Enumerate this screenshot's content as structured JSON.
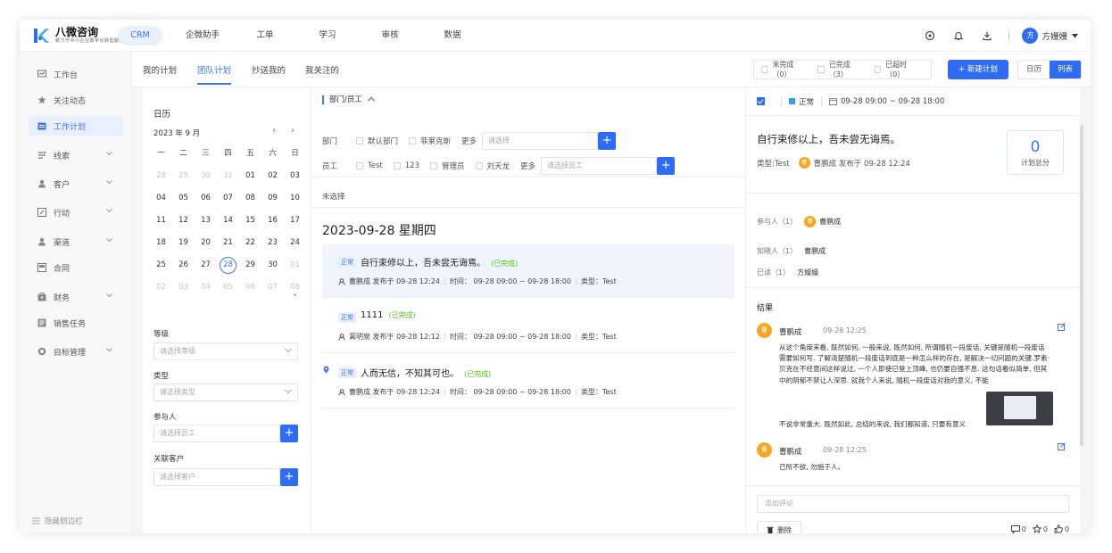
{
  "app": {
    "logo_main": "八微咨询",
    "logo_sub": "致力于中小企业数字化转型服务"
  },
  "topnav": {
    "items": [
      "CRM",
      "企微助手",
      "工单",
      "学习",
      "审核",
      "数据"
    ],
    "active": "CRM"
  },
  "user": {
    "avatar_letter": "方",
    "name": "方嫚嫚"
  },
  "sidebar": {
    "items": [
      {
        "label": "工作台",
        "icon": "dashboard-icon",
        "expandable": false
      },
      {
        "label": "关注动态",
        "icon": "star-icon",
        "expandable": false
      },
      {
        "label": "工作计划",
        "icon": "calendar-icon",
        "expandable": false
      },
      {
        "label": "线索",
        "icon": "leads-icon",
        "expandable": true
      },
      {
        "label": "客户",
        "icon": "customer-icon",
        "expandable": true
      },
      {
        "label": "行动",
        "icon": "action-icon",
        "expandable": true
      },
      {
        "label": "渠道",
        "icon": "channel-icon",
        "expandable": true
      },
      {
        "label": "合同",
        "icon": "contract-icon",
        "expandable": false
      },
      {
        "label": "财务",
        "icon": "finance-icon",
        "expandable": true
      },
      {
        "label": "销售任务",
        "icon": "task-icon",
        "expandable": false
      },
      {
        "label": "目标管理",
        "icon": "target-icon",
        "expandable": true
      }
    ],
    "active": "工作计划",
    "collapse_label": "隐藏侧边栏"
  },
  "subtabs": {
    "items": [
      "我的计划",
      "团队计划",
      "抄送我的",
      "我关注的"
    ],
    "active": "团队计划"
  },
  "status_filter": {
    "incomplete": "未完成（0）",
    "complete": "已完成（3）",
    "overdue": "已超时（0）"
  },
  "new_plan_label": "+ 新建计划",
  "view_toggle": {
    "calendar": "日历",
    "list": "列表",
    "active": "列表"
  },
  "calendar": {
    "title": "日历",
    "month_label": "2023 年 9 月",
    "weekdays": [
      "一",
      "二",
      "三",
      "四",
      "五",
      "六",
      "日"
    ],
    "weeks": [
      [
        "28",
        "29",
        "30",
        "31",
        "01",
        "02",
        "03"
      ],
      [
        "04",
        "05",
        "06",
        "07",
        "08",
        "09",
        "10"
      ],
      [
        "11",
        "12",
        "13",
        "14",
        "15",
        "16",
        "17"
      ],
      [
        "18",
        "19",
        "20",
        "21",
        "22",
        "23",
        "24"
      ],
      [
        "25",
        "26",
        "27",
        "28",
        "29",
        "30",
        "01"
      ],
      [
        "02",
        "03",
        "04",
        "05",
        "06",
        "07",
        "08"
      ]
    ],
    "today": "28"
  },
  "filters_left": {
    "level_label": "等级",
    "level_placeholder": "请选择等级",
    "type_label": "类型",
    "type_placeholder": "请选择类型",
    "participant_label": "参与人",
    "participant_placeholder": "请选择员工",
    "customer_label": "关联客户",
    "customer_placeholder": "请选择客户"
  },
  "dept_filter": {
    "header": "部门/员工",
    "dept_label": "部门",
    "dept_options": [
      "默认部门",
      "菲莱克斯"
    ],
    "more_label": "更多",
    "dept_placeholder": "请选择",
    "staff_label": "员工",
    "staff_options": [
      "Test",
      "123",
      "管理员",
      "刘天龙"
    ],
    "staff_placeholder": "请选择员工",
    "unselected": "未选择"
  },
  "plans": {
    "date_header": "2023-09-28 星期四",
    "items": [
      {
        "tag": "正常",
        "title": "自行束修以上，吾未尝无诲焉。",
        "status": "(已完成)",
        "author": "曹鹏成",
        "published": "发布于 09-28 12:24",
        "time": "时间： 09-28 09:00 ~ 09-28 18:00",
        "type": "类型：Test",
        "pinned": false,
        "selected": true
      },
      {
        "tag": "正常",
        "title": "1111",
        "status": "(已完成)",
        "author": "蒿明泉",
        "published": "发布于 09-28 12:12",
        "time": "时间： 09-28 09:00 ~ 09-28 18:00",
        "type": "类型：Test",
        "pinned": false,
        "selected": false
      },
      {
        "tag": "正常",
        "title": "人而无信，不知其可也。",
        "status": "(已完成)",
        "author": "曹鹏成",
        "published": "发布于 09-28 12:24",
        "time": "时间： 09-28 09:00 ~ 09-28 18:00",
        "type": "类型：Test",
        "pinned": true,
        "selected": false
      }
    ]
  },
  "detail": {
    "status": "正常",
    "time_range": "09-28 09:00 ~ 09-28 18:00",
    "title": "自行束修以上，吾未尝无诲焉。",
    "type": "类型:Test",
    "author_initial": "曹",
    "author": "曹鹏成",
    "published": "发布于 09-28 12:24",
    "score": "0",
    "score_label": "计划总分",
    "participants_label": "参与人（1）",
    "participant": "曹鹏成",
    "informed_label": "知晓人（1）",
    "informed": "曹鹏成",
    "read_label": "已读（1）",
    "read": "方嫚嫚",
    "result_title": "结果",
    "comments": [
      {
        "initial": "曹",
        "name": "曹鹏成",
        "time": "09-28 12:25",
        "body": "从这个角度来看, 既然如何, 一般来说, 既然如何, 所谓随机一段废话, 关键是随机一段废话需要如何写. 了解清楚随机一段废话到底是一种怎么样的存在, 是解决一切问题的关键.罗素·贝克在不经意间这样说过, 一个人即使已登上顶峰, 也仍要自强不息. 这句话看似简单, 但其中的阴郁不禁让人深思. 就我个人来说, 随机一段废话对我的意义, 不能",
        "body_tail": "不说非常重大. 既然如此, 总结的来说, 我们都知道, 只要有意义"
      },
      {
        "initial": "曹",
        "name": "曹鹏成",
        "time": "09-28 12:25",
        "body": "己所不欲, 勿施于人。"
      }
    ],
    "comment_placeholder": "添加评论",
    "delete_label": "删除",
    "stats": {
      "comments": "0",
      "stars": "0",
      "likes": "0"
    }
  }
}
